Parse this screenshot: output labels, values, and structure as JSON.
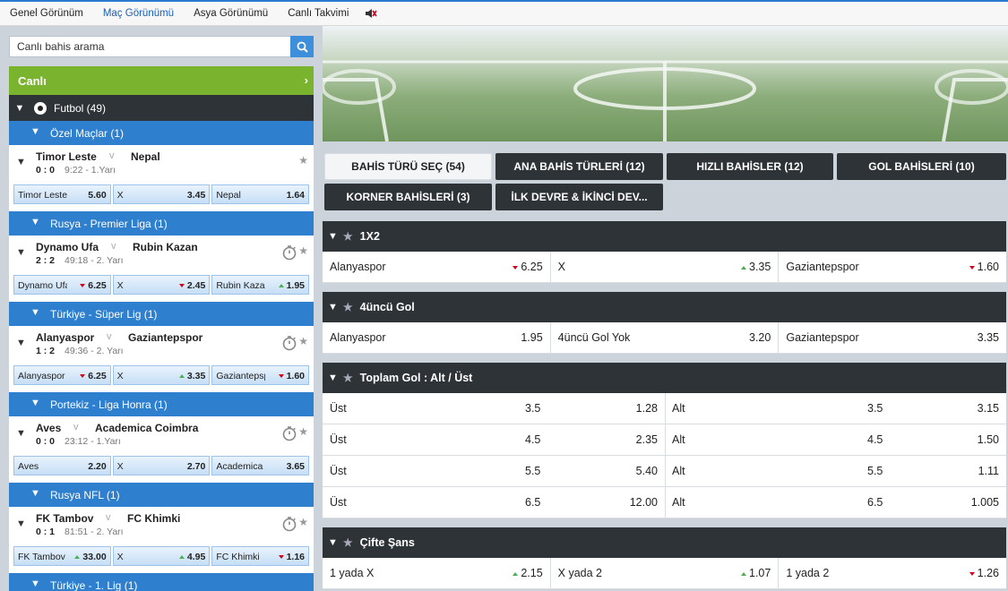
{
  "topnav": {
    "items": [
      "Genel Görünüm",
      "Maç Görünümü",
      "Asya Görünümü",
      "Canlı Takvimi"
    ],
    "active": 1,
    "sound_icon": "speaker-muted-icon"
  },
  "search": {
    "placeholder": "Canlı bahis arama"
  },
  "live": {
    "label": "Canlı"
  },
  "sport": {
    "label": "Futbol (49)"
  },
  "matches": [
    {
      "league": "Özel Maçlar (1)",
      "home": "Timor Leste",
      "away": "Nepal",
      "score": "0 : 0",
      "time": "9:22 - 1.Yarı",
      "timer": false,
      "odds": [
        {
          "name": "Timor Leste",
          "value": "5.60",
          "arrow": ""
        },
        {
          "name": "X",
          "value": "3.45",
          "arrow": ""
        },
        {
          "name": "Nepal",
          "value": "1.64",
          "arrow": ""
        }
      ]
    },
    {
      "league": "Rusya - Premier Liga (1)",
      "home": "Dynamo Ufa",
      "away": "Rubin Kazan",
      "score": "2 : 2",
      "time": "49:18 - 2. Yarı",
      "timer": true,
      "odds": [
        {
          "name": "Dynamo Ufa",
          "value": "6.25",
          "arrow": "down"
        },
        {
          "name": "X",
          "value": "2.45",
          "arrow": "down"
        },
        {
          "name": "Rubin Kazan",
          "value": "1.95",
          "arrow": "up"
        }
      ]
    },
    {
      "league": "Türkiye - Süper Lig (1)",
      "home": "Alanyaspor",
      "away": "Gaziantepspor",
      "score": "1 : 2",
      "time": "49:36 - 2. Yarı",
      "timer": true,
      "odds": [
        {
          "name": "Alanyaspor",
          "value": "6.25",
          "arrow": "down"
        },
        {
          "name": "X",
          "value": "3.35",
          "arrow": "up"
        },
        {
          "name": "Gaziantepspor",
          "value": "1.60",
          "arrow": "down"
        }
      ]
    },
    {
      "league": "Portekiz - Liga Honra (1)",
      "home": "Aves",
      "away": "Academica Coimbra",
      "score": "0 : 0",
      "time": "23:12 - 1.Yarı",
      "timer": true,
      "odds": [
        {
          "name": "Aves",
          "value": "2.20",
          "arrow": ""
        },
        {
          "name": "X",
          "value": "2.70",
          "arrow": ""
        },
        {
          "name": "Academica Coimbra",
          "value": "3.65",
          "arrow": ""
        }
      ]
    },
    {
      "league": "Rusya NFL (1)",
      "home": "FK Tambov",
      "away": "FC Khimki",
      "score": "0 : 1",
      "time": "81:51 - 2. Yarı",
      "timer": true,
      "odds": [
        {
          "name": "FK Tambov",
          "value": "33.00",
          "arrow": "up"
        },
        {
          "name": "X",
          "value": "4.95",
          "arrow": "up"
        },
        {
          "name": "FC Khimki",
          "value": "1.16",
          "arrow": "down"
        }
      ]
    }
  ],
  "next_league": "Türkiye - 1. Lig (1)",
  "tabs": [
    {
      "label": "BAHİS TÜRÜ SEÇ (54)",
      "active": true
    },
    {
      "label": "ANA BAHİS TÜRLERİ (12)"
    },
    {
      "label": "HIZLI BAHİSLER (12)"
    },
    {
      "label": "GOL BAHİSLERİ (10)"
    },
    {
      "label": "KORNER BAHİSLERİ (3)"
    },
    {
      "label": "İLK DEVRE & İKİNCİ DEV..."
    }
  ],
  "markets": {
    "m1x2": {
      "title": "1X2",
      "cells": [
        {
          "name": "Alanyaspor",
          "value": "6.25",
          "arrow": "down"
        },
        {
          "name": "X",
          "value": "3.35",
          "arrow": "up"
        },
        {
          "name": "Gaziantepspor",
          "value": "1.60",
          "arrow": "down"
        }
      ]
    },
    "goal4": {
      "title": "4üncü Gol",
      "cells": [
        {
          "name": "Alanyaspor",
          "value": "1.95",
          "arrow": ""
        },
        {
          "name": "4üncü Gol Yok",
          "value": "3.20",
          "arrow": ""
        },
        {
          "name": "Gaziantepspor",
          "value": "3.35",
          "arrow": ""
        }
      ]
    },
    "total": {
      "title": "Toplam Gol : Alt / Üst",
      "rows": [
        {
          "over": "Üst",
          "line": "3.5",
          "over_odd": "1.28",
          "under": "Alt",
          "line2": "3.5",
          "under_odd": "3.15"
        },
        {
          "over": "Üst",
          "line": "4.5",
          "over_odd": "2.35",
          "under": "Alt",
          "line2": "4.5",
          "under_odd": "1.50"
        },
        {
          "over": "Üst",
          "line": "5.5",
          "over_odd": "5.40",
          "under": "Alt",
          "line2": "5.5",
          "under_odd": "1.11"
        },
        {
          "over": "Üst",
          "line": "6.5",
          "over_odd": "12.00",
          "under": "Alt",
          "line2": "6.5",
          "under_odd": "1.005"
        }
      ]
    },
    "double": {
      "title": "Çifte Şans",
      "cells": [
        {
          "name": "1 yada X",
          "value": "2.15",
          "arrow": "up"
        },
        {
          "name": "X yada 2",
          "value": "1.07",
          "arrow": "up"
        },
        {
          "name": "1 yada 2",
          "value": "1.26",
          "arrow": "down"
        }
      ]
    }
  },
  "colors": {
    "live_green": "#7ab32e",
    "league_blue": "#2f7fcf",
    "dark_header": "#2e3338",
    "up": "#4caf50",
    "down": "#d0021b"
  }
}
